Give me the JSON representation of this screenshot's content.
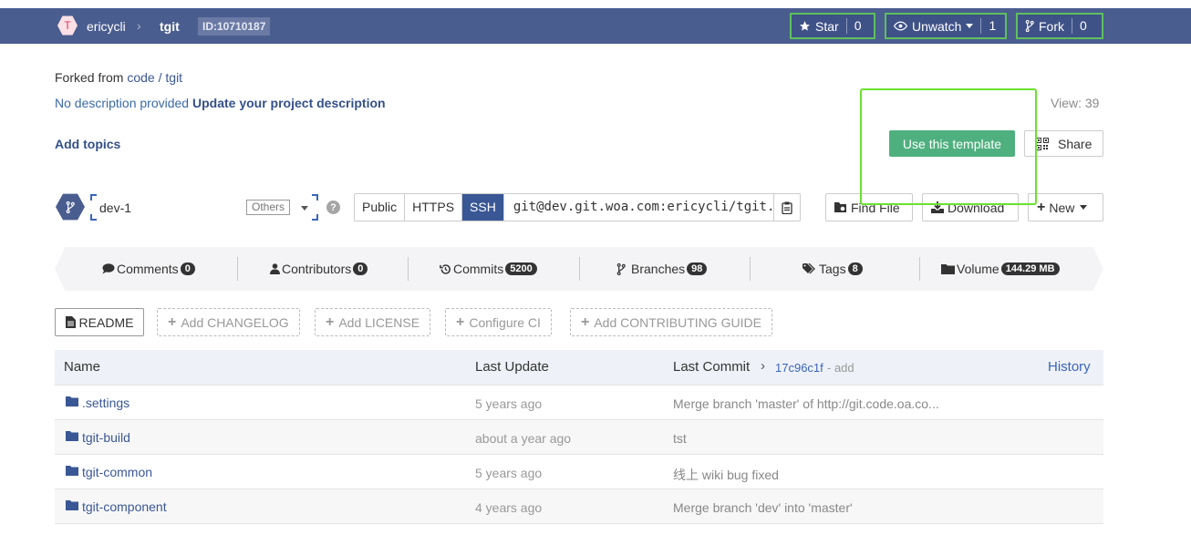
{
  "header": {
    "avatar_letter": "T",
    "owner": "ericycli",
    "separator": "›",
    "repo": "tgit",
    "repo_id": "ID:10710187",
    "star": {
      "label": "Star",
      "count": "0"
    },
    "watch": {
      "label": "Unwatch",
      "count": "1"
    },
    "fork": {
      "label": "Fork",
      "count": "0"
    }
  },
  "info": {
    "forked_prefix": "Forked from",
    "forked_link": "code / tgit",
    "no_description": "No description provided",
    "update_description": "Update your project description",
    "views": "View: 39",
    "add_topics": "Add topics",
    "use_template": "Use this template",
    "share": "Share"
  },
  "branch": {
    "name": "dev-1",
    "tag": "Others",
    "help": "?"
  },
  "clone": {
    "options": [
      "Public",
      "HTTPS",
      "SSH"
    ],
    "active": "SSH",
    "url": "git@dev.git.woa.com:ericycli/tgit.git"
  },
  "actions": {
    "find_file": "Find File",
    "download": "Download",
    "new": "New"
  },
  "stats": [
    {
      "label": "Comments",
      "count": "0",
      "icon": "comment-icon"
    },
    {
      "label": "Contributors",
      "count": "0",
      "icon": "user-icon"
    },
    {
      "label": "Commits",
      "count": "5200",
      "icon": "history-icon"
    },
    {
      "label": "Branches",
      "count": "98",
      "icon": "branch-icon"
    },
    {
      "label": "Tags",
      "count": "8",
      "icon": "tag-icon"
    },
    {
      "label": "Volume",
      "count": "144.29 MB",
      "icon": "folder-icon"
    }
  ],
  "quick": {
    "readme": "README",
    "add_changelog": "Add CHANGELOG",
    "add_license": "Add LICENSE",
    "configure_ci": "Configure CI",
    "add_contributing": "Add CONTRIBUTING GUIDE"
  },
  "files": {
    "headers": {
      "name": "Name",
      "last_update": "Last Update",
      "last_commit": "Last Commit",
      "commit_sha": "17c96c1f",
      "commit_msg": "- add",
      "history": "History"
    },
    "rows": [
      {
        "name": ".settings",
        "date": "5 years ago",
        "commit": "Merge branch 'master' of http://git.code.oa.co..."
      },
      {
        "name": "tgit-build",
        "date": "about a year ago",
        "commit": "tst"
      },
      {
        "name": "tgit-common",
        "date": "5 years ago",
        "commit": "线上 wiki bug fixed"
      },
      {
        "name": "tgit-component",
        "date": "4 years ago",
        "commit": "Merge branch 'dev' into 'master'"
      }
    ]
  },
  "colors": {
    "topbar": "#4a5d8f",
    "accent_green": "#4fb07f",
    "link": "#3a5795",
    "highlight": "#6be030"
  }
}
